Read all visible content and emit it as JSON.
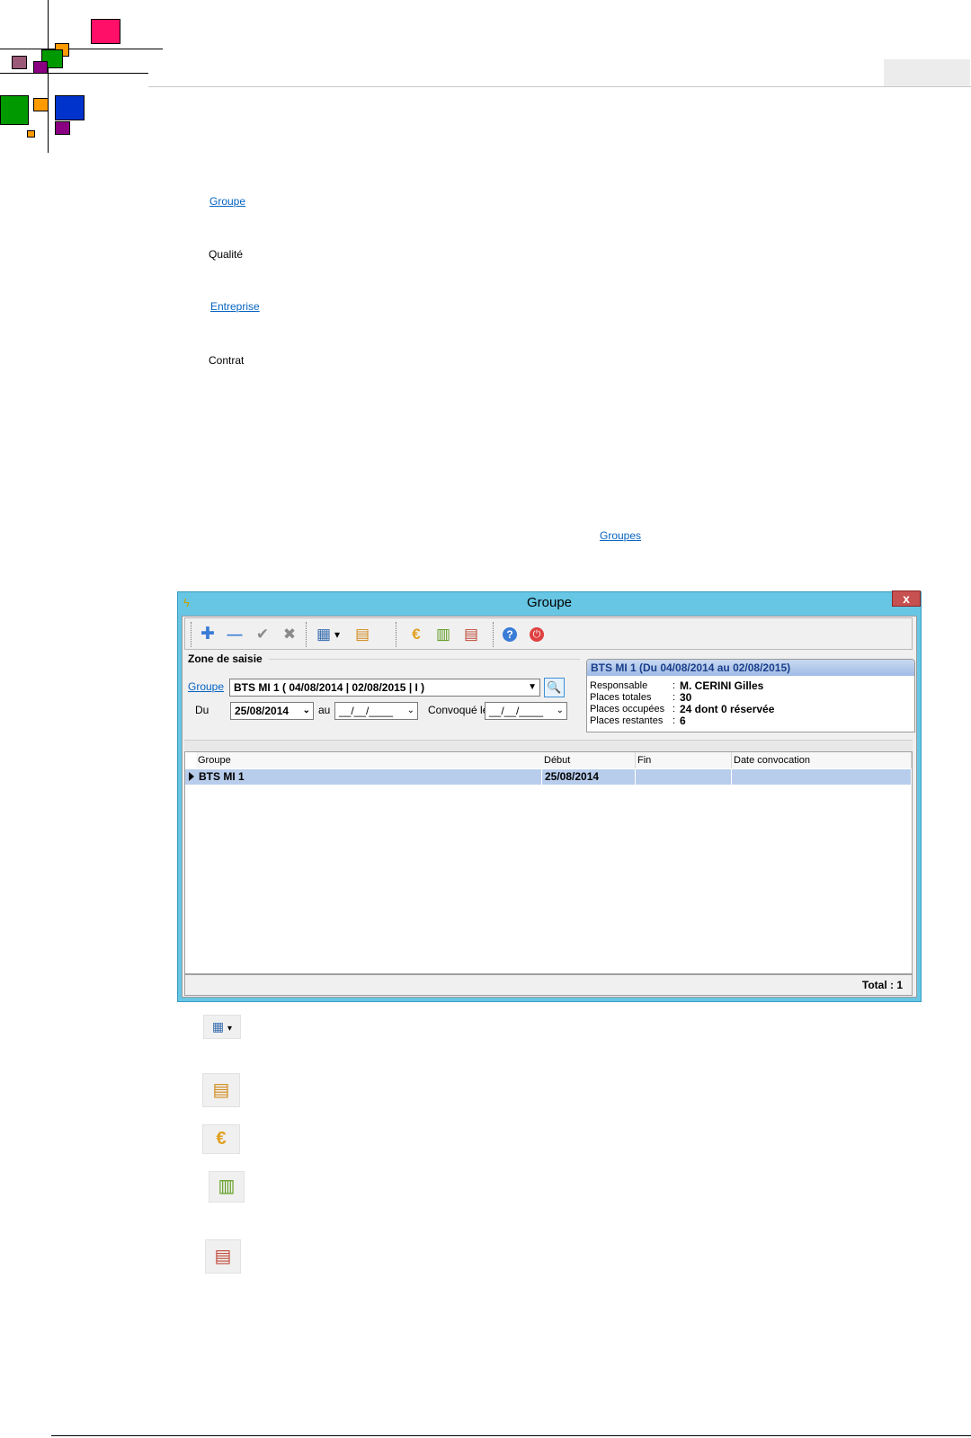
{
  "doc": {
    "links": {
      "groupe": "Groupe",
      "qualite": "Qualité",
      "entreprise": "Entreprise",
      "contrat": "Contrat",
      "groupes": "Groupes"
    }
  },
  "window": {
    "title": "Groupe",
    "close_label": "x",
    "logo_icon": "app-logo-icon",
    "toolbar": {
      "buttons": [
        {
          "name": "add-icon",
          "glyph": "✚"
        },
        {
          "name": "remove-icon",
          "glyph": "—"
        },
        {
          "name": "validate-icon",
          "glyph": "✔"
        },
        {
          "name": "cancel-icon",
          "glyph": "✖"
        },
        {
          "name": "grid-view-icon",
          "glyph": "▦"
        },
        {
          "name": "dropdown-arrow-icon",
          "glyph": "▾"
        },
        {
          "name": "edit-table-icon",
          "glyph": "▤"
        },
        {
          "name": "euro-icon",
          "glyph": "€"
        },
        {
          "name": "table-check-icon",
          "glyph": "▥"
        },
        {
          "name": "user-list-icon",
          "glyph": "▤"
        },
        {
          "name": "help-icon",
          "glyph": "?"
        },
        {
          "name": "power-icon",
          "glyph": "⏻"
        }
      ]
    },
    "form": {
      "section_title": "Zone de saisie",
      "groupe_label": "Groupe",
      "groupe_value": "BTS MI 1 ( 04/08/2014 | 02/08/2015 | I )",
      "du_label": "Du",
      "du_value": "25/08/2014",
      "au_label": "au",
      "au_value": "__/__/____",
      "convoque_label": "Convoqué le",
      "convoque_value": "__/__/____"
    },
    "info": {
      "title": "BTS MI 1 (Du 04/08/2014 au 02/08/2015)",
      "rows": [
        {
          "key": "Responsable",
          "value": "M. CERINI Gilles"
        },
        {
          "key": "Places totales",
          "value": "30"
        },
        {
          "key": "Places occupées",
          "value": "24 dont 0 réservée"
        },
        {
          "key": "Places restantes",
          "value": "6"
        }
      ]
    },
    "grid": {
      "columns": [
        "Groupe",
        "Début",
        "Fin",
        "Date convocation"
      ],
      "rows": [
        [
          "BTS MI 1",
          "25/08/2014",
          "",
          ""
        ]
      ]
    },
    "status": {
      "total": "Total : 1"
    }
  },
  "legend_icons": [
    {
      "name": "grid-view-dropdown-icon",
      "glyph": "▦ ▾"
    },
    {
      "name": "edit-table-icon",
      "glyph": "▤"
    },
    {
      "name": "euro-icon",
      "glyph": "€"
    },
    {
      "name": "table-check-icon",
      "glyph": "▥"
    },
    {
      "name": "user-list-icon",
      "glyph": "▤"
    }
  ],
  "colors": {
    "pink": "#ff0f68",
    "orange": "#ff9a00",
    "green": "#009a00",
    "purple": "#8b0082",
    "mauve": "#9b5a78",
    "blue": "#0033cc",
    "window_title": "#66c6e4",
    "link": "#0563c1",
    "selected_row": "#b8cdec"
  }
}
